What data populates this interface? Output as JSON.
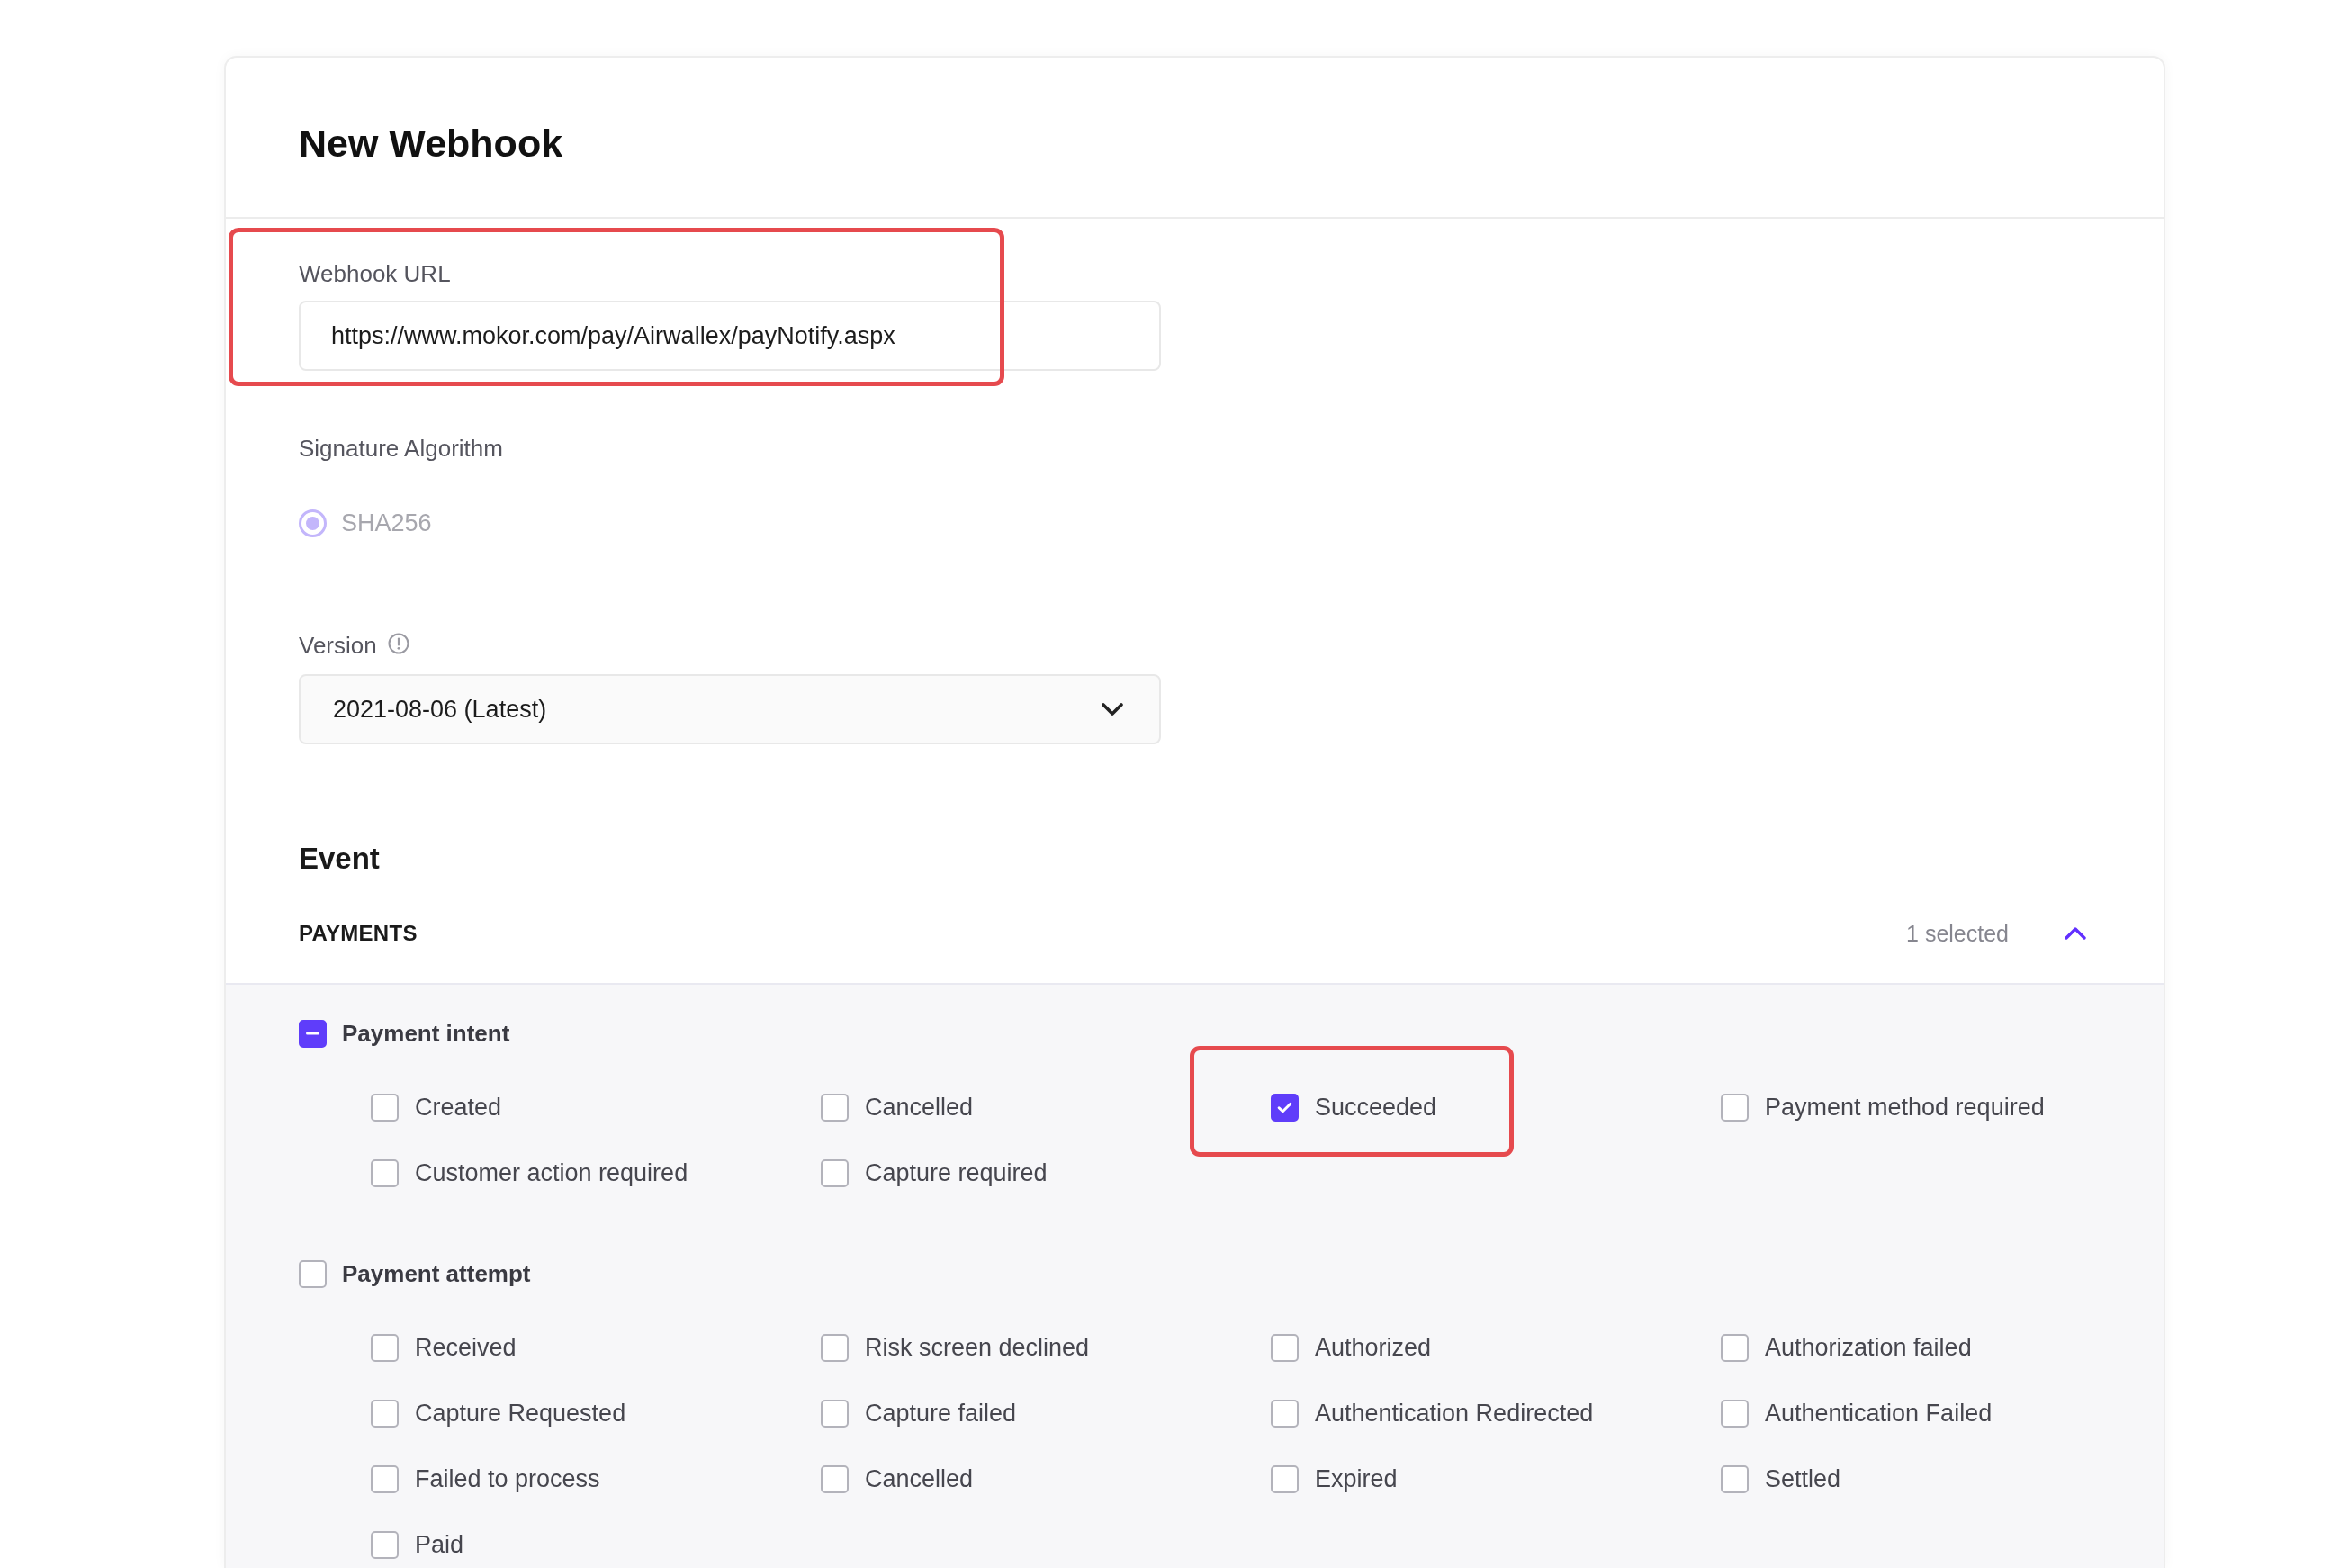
{
  "page": {
    "title": "New Webhook"
  },
  "webhook_url": {
    "label": "Webhook URL",
    "value": "https://www.mokor.com/pay/Airwallex/payNotify.aspx",
    "highlighted": true
  },
  "signature_algorithm": {
    "label": "Signature Algorithm",
    "options": [
      {
        "label": "SHA256",
        "selected": true,
        "disabled": true
      }
    ]
  },
  "version": {
    "label": "Version",
    "value": "2021-08-06 (Latest)"
  },
  "event": {
    "heading": "Event",
    "category": {
      "label": "PAYMENTS",
      "count": "1 selected",
      "expanded": true
    },
    "groups": [
      {
        "label": "Payment intent",
        "indeterminate": true,
        "items": [
          {
            "label": "Created",
            "checked": false,
            "highlighted": false
          },
          {
            "label": "Cancelled",
            "checked": false,
            "highlighted": false
          },
          {
            "label": "Succeeded",
            "checked": true,
            "highlighted": true
          },
          {
            "label": "Payment method required",
            "checked": false,
            "highlighted": false
          },
          {
            "label": "Customer action required",
            "checked": false,
            "highlighted": false
          },
          {
            "label": "Capture required",
            "checked": false,
            "highlighted": false
          }
        ]
      },
      {
        "label": "Payment attempt",
        "indeterminate": false,
        "items": [
          {
            "label": "Received",
            "checked": false,
            "highlighted": false
          },
          {
            "label": "Risk screen declined",
            "checked": false,
            "highlighted": false
          },
          {
            "label": "Authorized",
            "checked": false,
            "highlighted": false
          },
          {
            "label": "Authorization failed",
            "checked": false,
            "highlighted": false
          },
          {
            "label": "Capture Requested",
            "checked": false,
            "highlighted": false
          },
          {
            "label": "Capture failed",
            "checked": false,
            "highlighted": false
          },
          {
            "label": "Authentication Redirected",
            "checked": false,
            "highlighted": false
          },
          {
            "label": "Authentication Failed",
            "checked": false,
            "highlighted": false
          },
          {
            "label": "Failed to process",
            "checked": false,
            "highlighted": false
          },
          {
            "label": "Cancelled",
            "checked": false,
            "highlighted": false
          },
          {
            "label": "Expired",
            "checked": false,
            "highlighted": false
          },
          {
            "label": "Settled",
            "checked": false,
            "highlighted": false
          },
          {
            "label": "Paid",
            "checked": false,
            "highlighted": false
          }
        ]
      }
    ]
  }
}
